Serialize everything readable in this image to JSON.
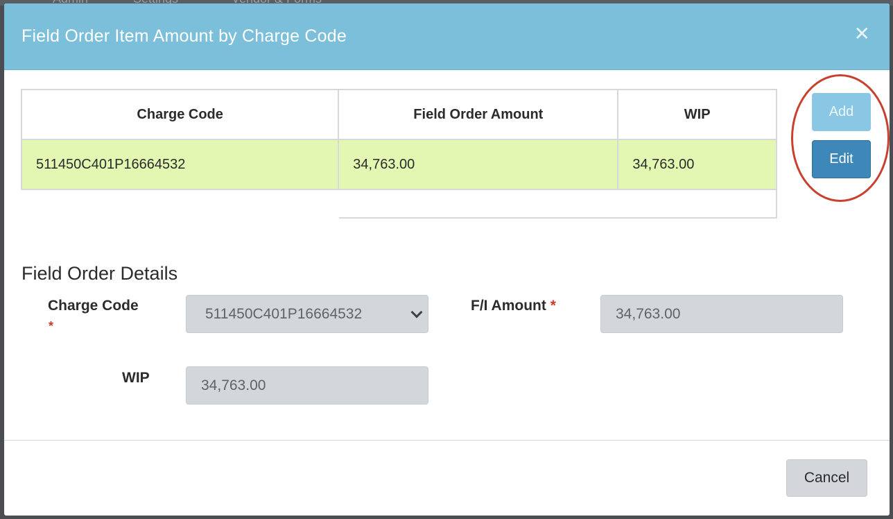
{
  "background_nav": [
    "Admin",
    "Settings",
    "Vendor & Forms"
  ],
  "modal": {
    "title": "Field Order Item Amount by Charge Code",
    "close_icon": "close-icon",
    "header_color": "#7bbfdb"
  },
  "table": {
    "columns": [
      "Charge Code",
      "Field Order Amount",
      "WIP"
    ],
    "rows": [
      {
        "charge_code": "511450C401P16664532",
        "field_order_amount": "34,763.00",
        "wip": "34,763.00"
      }
    ],
    "selected_row_color": "#e3f6b2"
  },
  "actions": {
    "add_label": "Add",
    "edit_label": "Edit"
  },
  "details": {
    "title": "Field Order Details",
    "charge_code_label": "Charge Code",
    "charge_code_value": "511450C401P16664532",
    "fi_amount_label": "F/I Amount",
    "fi_amount_value": "34,763.00",
    "wip_label": "WIP",
    "wip_value": "34,763.00",
    "required_mark": "*"
  },
  "footer": {
    "cancel_label": "Cancel"
  }
}
